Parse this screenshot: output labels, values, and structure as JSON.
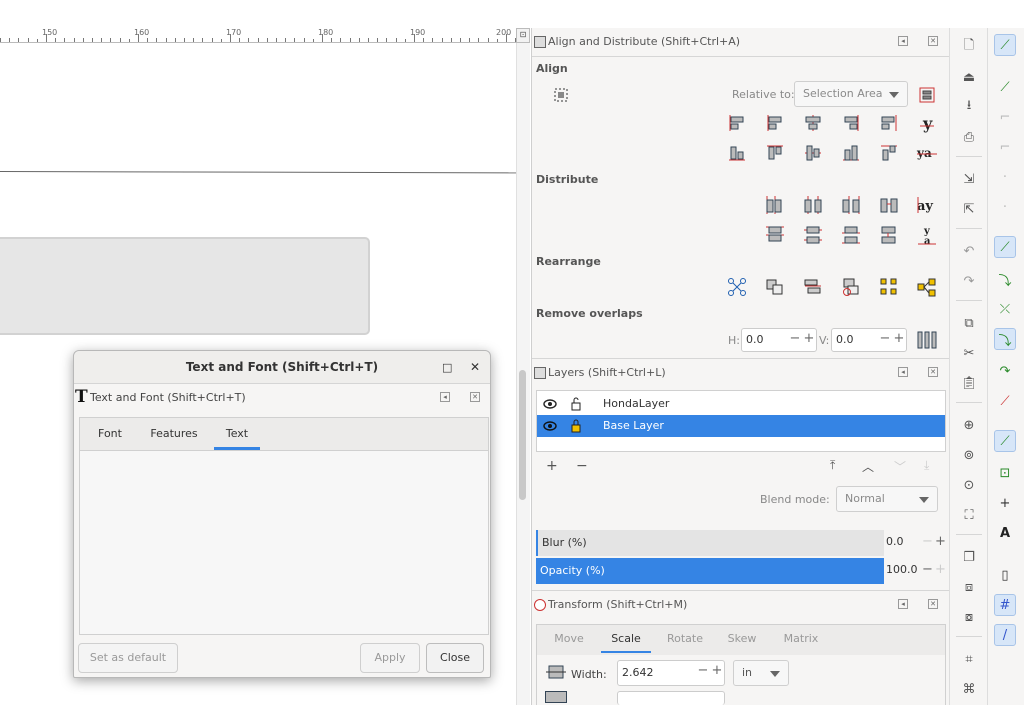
{
  "ruler": {
    "labels": [
      "150",
      "160",
      "170",
      "180",
      "190",
      "200"
    ]
  },
  "align_panel": {
    "title": "Align and Distribute (Shift+Ctrl+A)",
    "align_label": "Align",
    "relative_to_label": "Relative to:",
    "relative_to_value": "Selection Area",
    "distribute_label": "Distribute",
    "rearrange_label": "Rearrange",
    "remove_overlaps_label": "Remove overlaps",
    "h_label": "H:",
    "h_value": "0.0",
    "v_label": "V:",
    "v_value": "0.0"
  },
  "layers_panel": {
    "title": "Layers (Shift+Ctrl+L)",
    "layers": [
      {
        "name": "HondaLayer",
        "selected": false
      },
      {
        "name": "Base Layer",
        "selected": true
      }
    ],
    "add_label": "+",
    "remove_label": "−",
    "blend_label": "Blend mode:",
    "blend_value": "Normal",
    "blur_label": "Blur (%)",
    "blur_value": "0.0",
    "opacity_label": "Opacity (%)",
    "opacity_value": "100.0",
    "opacity_fraction": 1.0
  },
  "transform_panel": {
    "title": "Transform (Shift+Ctrl+M)",
    "tabs": [
      "Move",
      "Scale",
      "Rotate",
      "Skew",
      "Matrix"
    ],
    "active_tab": "Scale",
    "width_label": "Width:",
    "width_value": "2.642",
    "unit_value": "in"
  },
  "text_dialog": {
    "window_title": "Text and Font (Shift+Ctrl+T)",
    "panel_title": "Text and Font (Shift+Ctrl+T)",
    "tabs": [
      "Font",
      "Features",
      "Text"
    ],
    "active_tab": "Text",
    "set_default_label": "Set as default",
    "apply_label": "Apply",
    "close_label": "Close"
  },
  "colors": {
    "accent": "#3584e4",
    "panel_bg": "#f6f5f4"
  }
}
